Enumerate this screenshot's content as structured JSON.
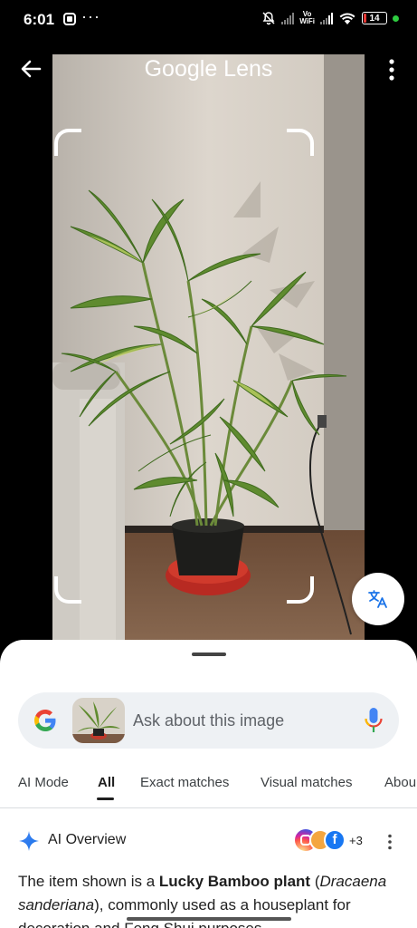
{
  "status_bar": {
    "time": "6:01",
    "dots": "···",
    "vowifi_top": "Vo",
    "vowifi_bottom": "WiFi",
    "battery": "14",
    "battery_level_percent": 14
  },
  "top_bar": {
    "title": "Google Lens",
    "back_icon": "arrow-left-icon",
    "more_icon": "more-vert-icon"
  },
  "photo": {
    "subject": "plant-photo",
    "translate_icon": "translate-icon"
  },
  "search": {
    "placeholder": "Ask about this image",
    "logo": "google-g-icon",
    "mic_icon": "mic-icon"
  },
  "tabs": [
    {
      "label": "AI Mode",
      "active": false
    },
    {
      "label": "All",
      "active": true
    },
    {
      "label": "Exact matches",
      "active": false
    },
    {
      "label": "Visual matches",
      "active": false
    },
    {
      "label": "Abou",
      "active": false
    }
  ],
  "ai_overview": {
    "label": "AI Overview",
    "source_count": "+3",
    "text_1": "The item shown is a ",
    "text_bold": "Lucky Bamboo plant",
    "text_2": " (",
    "text_italic_1": "Dracaena sanderiana",
    "text_3": "), commonly used as a houseplant for",
    "text_4": "decoration and Feng Shui purposes"
  },
  "colors": {
    "accent_blue": "#1a73e8",
    "sheet_bg": "#ffffff",
    "search_bg": "#eef1f4",
    "battery_red": "#e53935",
    "status_green": "#2ecc40"
  }
}
